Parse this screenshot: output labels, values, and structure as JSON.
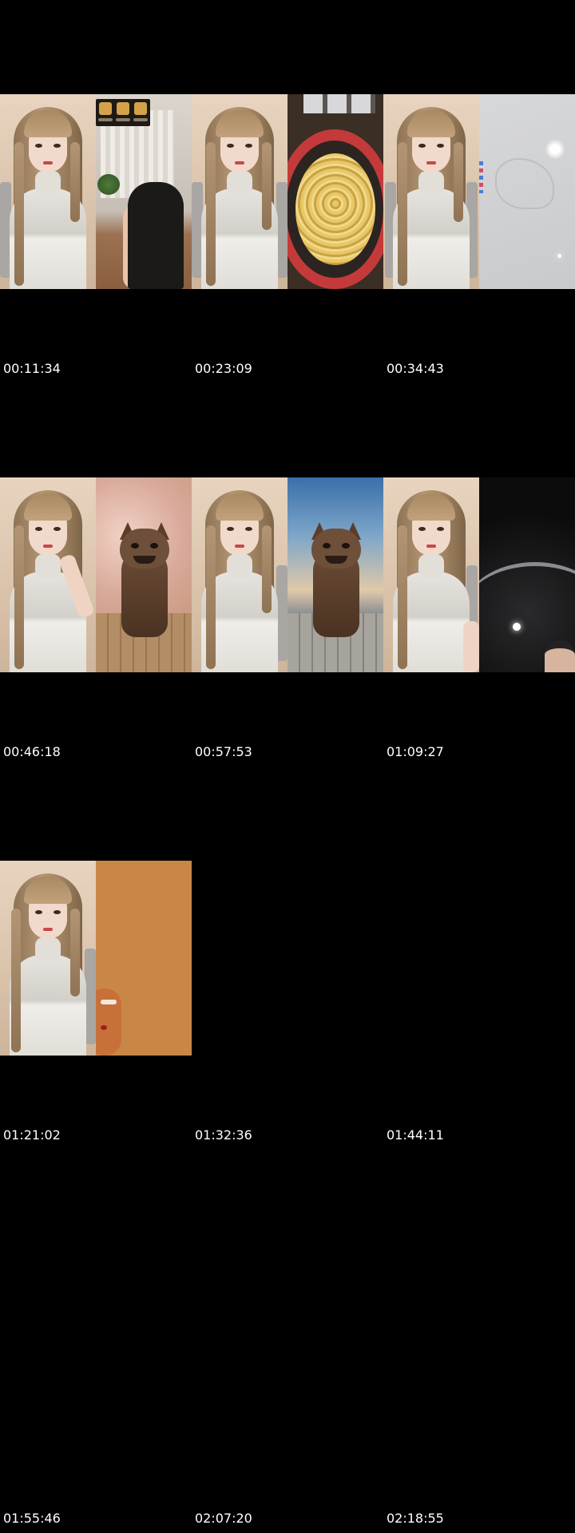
{
  "contact_sheet": {
    "rows": [
      {
        "frames": [
          "person-sweater",
          "room-shelf-figure",
          "person-sweater",
          "ramen-bowl",
          "person-sweater",
          "whiteboard-glare"
        ],
        "timestamps": [
          "00:11:34",
          "00:23:09",
          "00:34:43"
        ]
      },
      {
        "frames": [
          "person-hand-on-face",
          "cat-blossom",
          "person-sweater",
          "cat-sky",
          "person-sweater",
          "dark-room-face"
        ],
        "timestamps": [
          "00:46:18",
          "00:57:53",
          "01:09:27"
        ]
      },
      {
        "frames": [
          "person-sweater",
          "orange-mascot"
        ],
        "timestamps": [
          "01:21:02",
          "01:32:36",
          "01:44:11"
        ]
      },
      {
        "frames": [],
        "timestamps": [
          "01:55:46",
          "02:07:20",
          "02:18:55"
        ]
      }
    ],
    "background_color": "#000000"
  }
}
